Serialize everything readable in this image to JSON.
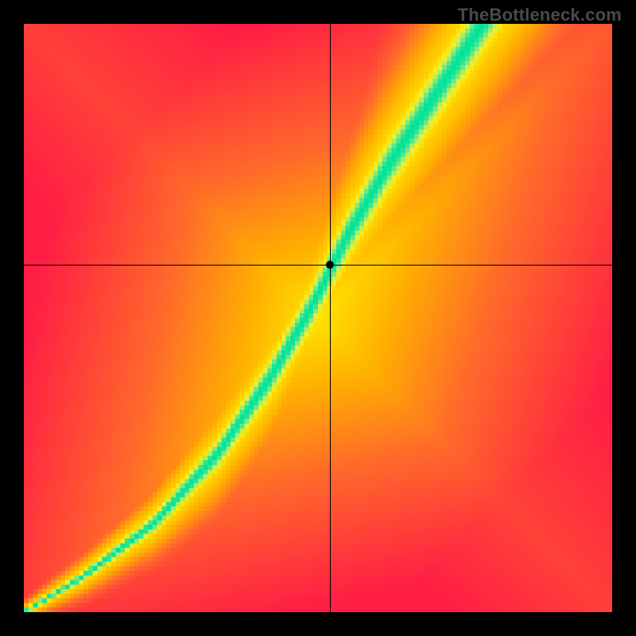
{
  "watermark": "TheBottleneck.com",
  "chart_data": {
    "type": "heatmap",
    "title": "",
    "xlabel": "",
    "ylabel": "",
    "xlim": [
      0,
      1
    ],
    "ylim": [
      0,
      1
    ],
    "grid_resolution": 128,
    "crosshair": {
      "x": 0.52,
      "y": 0.59
    },
    "marker": {
      "x": 0.52,
      "y": 0.59
    },
    "ridge_control_points": [
      {
        "x": 0.0,
        "y": 0.0
      },
      {
        "x": 0.1,
        "y": 0.06
      },
      {
        "x": 0.22,
        "y": 0.15
      },
      {
        "x": 0.33,
        "y": 0.27
      },
      {
        "x": 0.42,
        "y": 0.4
      },
      {
        "x": 0.49,
        "y": 0.52
      },
      {
        "x": 0.55,
        "y": 0.64
      },
      {
        "x": 0.62,
        "y": 0.76
      },
      {
        "x": 0.7,
        "y": 0.88
      },
      {
        "x": 0.78,
        "y": 1.0
      }
    ],
    "ridge_width_control_points": [
      {
        "x": 0.0,
        "w": 0.006
      },
      {
        "x": 0.2,
        "w": 0.02
      },
      {
        "x": 0.4,
        "w": 0.045
      },
      {
        "x": 0.6,
        "w": 0.06
      },
      {
        "x": 0.8,
        "w": 0.07
      },
      {
        "x": 1.0,
        "w": 0.078
      }
    ],
    "background_bias": 0.45,
    "color_stops": [
      {
        "t": 0.0,
        "color": "#ff1e44"
      },
      {
        "t": 0.35,
        "color": "#ff6a2a"
      },
      {
        "t": 0.58,
        "color": "#ffb000"
      },
      {
        "t": 0.75,
        "color": "#ffe200"
      },
      {
        "t": 0.86,
        "color": "#e8f23a"
      },
      {
        "t": 0.94,
        "color": "#6be88d"
      },
      {
        "t": 1.0,
        "color": "#00e39a"
      }
    ]
  }
}
